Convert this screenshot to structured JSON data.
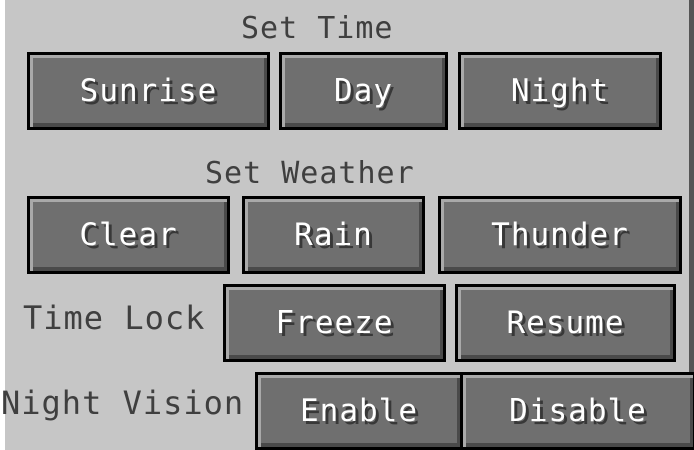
{
  "time": {
    "heading": "Set Time",
    "sunrise": "Sunrise",
    "day": "Day",
    "night": "Night"
  },
  "weather": {
    "heading": "Set Weather",
    "clear": "Clear",
    "rain": "Rain",
    "thunder": "Thunder"
  },
  "time_lock": {
    "label": "Time Lock",
    "freeze": "Freeze",
    "resume": "Resume"
  },
  "night_vision": {
    "label": "Night Vision",
    "enable": "Enable",
    "disable": "Disable"
  }
}
